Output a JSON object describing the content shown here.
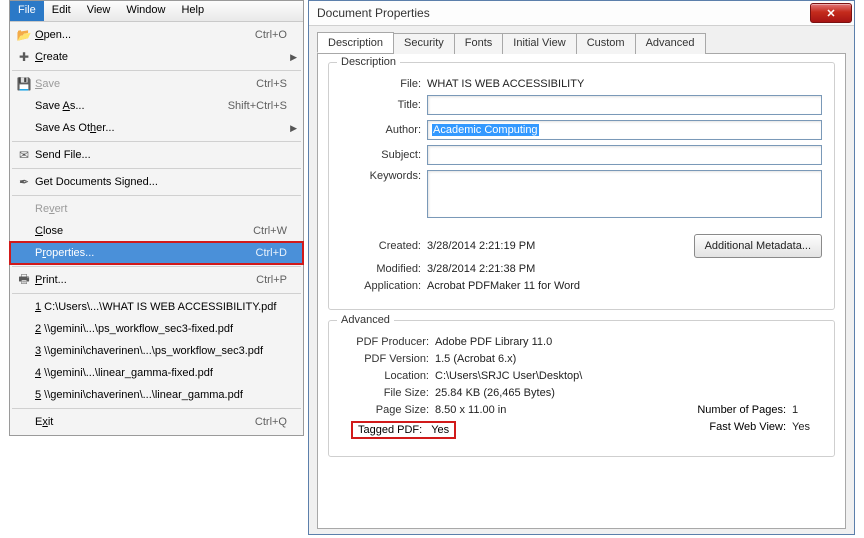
{
  "menubar": {
    "items": [
      "File",
      "Edit",
      "View",
      "Window",
      "Help"
    ]
  },
  "menu": {
    "open": {
      "label": "Open...",
      "shortcut": "Ctrl+O"
    },
    "create": {
      "label": "Create"
    },
    "save": {
      "label": "Save",
      "shortcut": "Ctrl+S"
    },
    "saveAs": {
      "label": "Save As...",
      "shortcut": "Shift+Ctrl+S"
    },
    "saveAsOther": {
      "label": "Save As Other..."
    },
    "sendFile": {
      "label": "Send File..."
    },
    "getSigned": {
      "label": "Get Documents Signed..."
    },
    "revert": {
      "label": "Revert"
    },
    "close": {
      "label": "Close",
      "shortcut": "Ctrl+W"
    },
    "properties": {
      "label": "Properties...",
      "shortcut": "Ctrl+D"
    },
    "print": {
      "label": "Print...",
      "shortcut": "Ctrl+P"
    },
    "recent": [
      "1 C:\\Users\\...\\WHAT IS WEB ACCESSIBILITY.pdf",
      "2 \\\\gemini\\...\\ps_workflow_sec3-fixed.pdf",
      "3 \\\\gemini\\chaverinen\\...\\ps_workflow_sec3.pdf",
      "4 \\\\gemini\\...\\linear_gamma-fixed.pdf",
      "5 \\\\gemini\\chaverinen\\...\\linear_gamma.pdf"
    ],
    "exit": {
      "label": "Exit",
      "shortcut": "Ctrl+Q"
    }
  },
  "dialog": {
    "title": "Document Properties",
    "tabs": [
      "Description",
      "Security",
      "Fonts",
      "Initial View",
      "Custom",
      "Advanced"
    ],
    "desc": {
      "group": "Description",
      "file": {
        "label": "File:",
        "value": "WHAT IS WEB ACCESSIBILITY"
      },
      "title": {
        "label": "Title:",
        "value": ""
      },
      "author": {
        "label": "Author:",
        "value": "Academic Computing"
      },
      "subject": {
        "label": "Subject:",
        "value": ""
      },
      "keywords": {
        "label": "Keywords:",
        "value": ""
      },
      "created": {
        "label": "Created:",
        "value": "3/28/2014 2:21:19 PM"
      },
      "modified": {
        "label": "Modified:",
        "value": "3/28/2014 2:21:38 PM"
      },
      "application": {
        "label": "Application:",
        "value": "Acrobat PDFMaker 11 for Word"
      },
      "metaBtn": "Additional Metadata..."
    },
    "adv": {
      "group": "Advanced",
      "producer": {
        "label": "PDF Producer:",
        "value": "Adobe PDF Library 11.0"
      },
      "version": {
        "label": "PDF Version:",
        "value": "1.5 (Acrobat 6.x)"
      },
      "location": {
        "label": "Location:",
        "value": "C:\\Users\\SRJC User\\Desktop\\"
      },
      "fileSize": {
        "label": "File Size:",
        "value": "25.84 KB (26,465 Bytes)"
      },
      "pageSize": {
        "label": "Page Size:",
        "value": "8.50 x 11.00 in"
      },
      "numPages": {
        "label": "Number of Pages:",
        "value": "1"
      },
      "tagged": {
        "label": "Tagged PDF:",
        "value": "Yes"
      },
      "fastWeb": {
        "label": "Fast Web View:",
        "value": "Yes"
      }
    }
  }
}
